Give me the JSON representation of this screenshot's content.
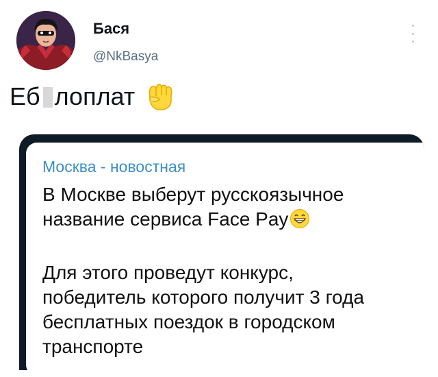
{
  "tweet": {
    "author_name": "Бася",
    "author_handle": "@NkBasya",
    "text_before": "Еб",
    "text_after": "лоплат",
    "emoji_icon": "raised-fist-icon"
  },
  "embed": {
    "channel_name": "Москва - новостная",
    "paragraph1_lines": [
      "В Москве выберут русскоязычное",
      "название сервиса Face Pay"
    ],
    "paragraph1_emoji_icon": "grinning-face-icon",
    "paragraph2_lines": [
      "Для этого проведут конкурс,",
      "победитель которого получит 3 года",
      "бесплатных поездок в городском",
      "транспорте"
    ]
  },
  "colors": {
    "handle": "#5b7083",
    "channel_name": "#3d8ec9",
    "embed_background": "#0f1b26"
  }
}
